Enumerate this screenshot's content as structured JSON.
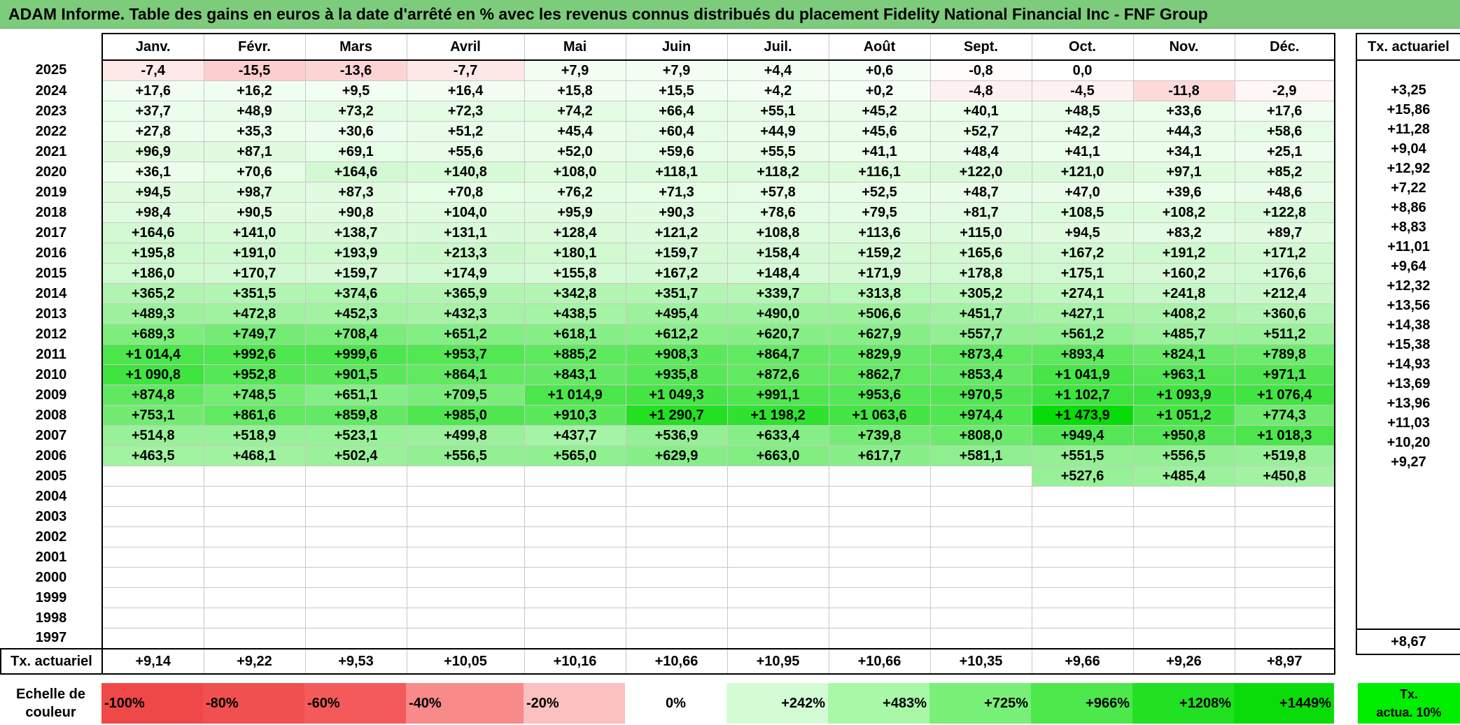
{
  "title": "ADAM Informe. Table des gains en euros à la date d'arrêté en % avec les revenus connus distribués du placement Fidelity National Financial Inc - FNF Group",
  "months": [
    "Janv.",
    "Févr.",
    "Mars",
    "Avril",
    "Mai",
    "Juin",
    "Juil.",
    "Août",
    "Sept.",
    "Oct.",
    "Nov.",
    "Déc."
  ],
  "side_header": "Tx. actuariel",
  "rows": [
    {
      "year": "2025",
      "cells": [
        "-7,4",
        "-15,5",
        "-13,6",
        "-7,7",
        "+7,9",
        "+7,9",
        "+4,4",
        "+0,6",
        "-0,8",
        "0,0",
        "",
        ""
      ],
      "tx": ""
    },
    {
      "year": "2024",
      "cells": [
        "+17,6",
        "+16,2",
        "+9,5",
        "+16,4",
        "+15,8",
        "+15,5",
        "+4,2",
        "+0,2",
        "-4,8",
        "-4,5",
        "-11,8",
        "-2,9"
      ],
      "tx": "+3,25"
    },
    {
      "year": "2023",
      "cells": [
        "+37,7",
        "+48,9",
        "+73,2",
        "+72,3",
        "+74,2",
        "+66,4",
        "+55,1",
        "+45,2",
        "+40,1",
        "+48,5",
        "+33,6",
        "+17,6"
      ],
      "tx": "+15,86"
    },
    {
      "year": "2022",
      "cells": [
        "+27,8",
        "+35,3",
        "+30,6",
        "+51,2",
        "+45,4",
        "+60,4",
        "+44,9",
        "+45,6",
        "+52,7",
        "+42,2",
        "+44,3",
        "+58,6"
      ],
      "tx": "+11,28"
    },
    {
      "year": "2021",
      "cells": [
        "+96,9",
        "+87,1",
        "+69,1",
        "+55,6",
        "+52,0",
        "+59,6",
        "+55,5",
        "+41,1",
        "+48,4",
        "+41,1",
        "+34,1",
        "+25,1"
      ],
      "tx": "+9,04"
    },
    {
      "year": "2020",
      "cells": [
        "+36,1",
        "+70,6",
        "+164,6",
        "+140,8",
        "+108,0",
        "+118,1",
        "+118,2",
        "+116,1",
        "+122,0",
        "+121,0",
        "+97,1",
        "+85,2"
      ],
      "tx": "+12,92"
    },
    {
      "year": "2019",
      "cells": [
        "+94,5",
        "+98,7",
        "+87,3",
        "+70,8",
        "+76,2",
        "+71,3",
        "+57,8",
        "+52,5",
        "+48,7",
        "+47,0",
        "+39,6",
        "+48,6"
      ],
      "tx": "+7,22"
    },
    {
      "year": "2018",
      "cells": [
        "+98,4",
        "+90,5",
        "+90,8",
        "+104,0",
        "+95,9",
        "+90,3",
        "+78,6",
        "+79,5",
        "+81,7",
        "+108,5",
        "+108,2",
        "+122,8"
      ],
      "tx": "+8,86"
    },
    {
      "year": "2017",
      "cells": [
        "+164,6",
        "+141,0",
        "+138,7",
        "+131,1",
        "+128,4",
        "+121,2",
        "+108,8",
        "+113,6",
        "+115,0",
        "+94,5",
        "+83,2",
        "+89,7"
      ],
      "tx": "+8,83"
    },
    {
      "year": "2016",
      "cells": [
        "+195,8",
        "+191,0",
        "+193,9",
        "+213,3",
        "+180,1",
        "+159,7",
        "+158,4",
        "+159,2",
        "+165,6",
        "+167,2",
        "+191,2",
        "+171,2"
      ],
      "tx": "+11,01"
    },
    {
      "year": "2015",
      "cells": [
        "+186,0",
        "+170,7",
        "+159,7",
        "+174,9",
        "+155,8",
        "+167,2",
        "+148,4",
        "+171,9",
        "+178,8",
        "+175,1",
        "+160,2",
        "+176,6"
      ],
      "tx": "+9,64"
    },
    {
      "year": "2014",
      "cells": [
        "+365,2",
        "+351,5",
        "+374,6",
        "+365,9",
        "+342,8",
        "+351,7",
        "+339,7",
        "+313,8",
        "+305,2",
        "+274,1",
        "+241,8",
        "+212,4"
      ],
      "tx": "+12,32"
    },
    {
      "year": "2013",
      "cells": [
        "+489,3",
        "+472,8",
        "+452,3",
        "+432,3",
        "+438,5",
        "+495,4",
        "+490,0",
        "+506,6",
        "+451,7",
        "+427,1",
        "+408,2",
        "+360,6"
      ],
      "tx": "+13,56"
    },
    {
      "year": "2012",
      "cells": [
        "+689,3",
        "+749,7",
        "+708,4",
        "+651,2",
        "+618,1",
        "+612,2",
        "+620,7",
        "+627,9",
        "+557,7",
        "+561,2",
        "+485,7",
        "+511,2"
      ],
      "tx": "+14,38"
    },
    {
      "year": "2011",
      "cells": [
        "+1 014,4",
        "+992,6",
        "+999,6",
        "+953,7",
        "+885,2",
        "+908,3",
        "+864,7",
        "+829,9",
        "+873,4",
        "+893,4",
        "+824,1",
        "+789,8"
      ],
      "tx": "+15,38"
    },
    {
      "year": "2010",
      "cells": [
        "+1 090,8",
        "+952,8",
        "+901,5",
        "+864,1",
        "+843,1",
        "+935,8",
        "+872,6",
        "+862,7",
        "+853,4",
        "+1 041,9",
        "+963,1",
        "+971,1"
      ],
      "tx": "+14,93"
    },
    {
      "year": "2009",
      "cells": [
        "+874,8",
        "+748,5",
        "+651,1",
        "+709,5",
        "+1 014,9",
        "+1 049,3",
        "+991,1",
        "+953,6",
        "+970,5",
        "+1 102,7",
        "+1 093,9",
        "+1 076,4"
      ],
      "tx": "+13,69"
    },
    {
      "year": "2008",
      "cells": [
        "+753,1",
        "+861,6",
        "+859,8",
        "+985,0",
        "+910,3",
        "+1 290,7",
        "+1 198,2",
        "+1 063,6",
        "+974,4",
        "+1 473,9",
        "+1 051,2",
        "+774,3"
      ],
      "tx": "+13,96"
    },
    {
      "year": "2007",
      "cells": [
        "+514,8",
        "+518,9",
        "+523,1",
        "+499,8",
        "+437,7",
        "+536,9",
        "+633,4",
        "+739,8",
        "+808,0",
        "+949,4",
        "+950,8",
        "+1 018,3"
      ],
      "tx": "+11,03"
    },
    {
      "year": "2006",
      "cells": [
        "+463,5",
        "+468,1",
        "+502,4",
        "+556,5",
        "+565,0",
        "+629,9",
        "+663,0",
        "+617,7",
        "+581,1",
        "+551,5",
        "+556,5",
        "+519,8"
      ],
      "tx": "+10,20"
    },
    {
      "year": "2005",
      "cells": [
        "",
        "",
        "",
        "",
        "",
        "",
        "",
        "",
        "",
        "+527,6",
        "+485,4",
        "+450,8"
      ],
      "tx": "+9,27"
    },
    {
      "year": "2004",
      "cells": [
        "",
        "",
        "",
        "",
        "",
        "",
        "",
        "",
        "",
        "",
        "",
        ""
      ],
      "tx": ""
    },
    {
      "year": "2003",
      "cells": [
        "",
        "",
        "",
        "",
        "",
        "",
        "",
        "",
        "",
        "",
        "",
        ""
      ],
      "tx": ""
    },
    {
      "year": "2002",
      "cells": [
        "",
        "",
        "",
        "",
        "",
        "",
        "",
        "",
        "",
        "",
        "",
        ""
      ],
      "tx": ""
    },
    {
      "year": "2001",
      "cells": [
        "",
        "",
        "",
        "",
        "",
        "",
        "",
        "",
        "",
        "",
        "",
        ""
      ],
      "tx": ""
    },
    {
      "year": "2000",
      "cells": [
        "",
        "",
        "",
        "",
        "",
        "",
        "",
        "",
        "",
        "",
        "",
        ""
      ],
      "tx": ""
    },
    {
      "year": "1999",
      "cells": [
        "",
        "",
        "",
        "",
        "",
        "",
        "",
        "",
        "",
        "",
        "",
        ""
      ],
      "tx": ""
    },
    {
      "year": "1998",
      "cells": [
        "",
        "",
        "",
        "",
        "",
        "",
        "",
        "",
        "",
        "",
        "",
        ""
      ],
      "tx": ""
    },
    {
      "year": "1997",
      "cells": [
        "",
        "",
        "",
        "",
        "",
        "",
        "",
        "",
        "",
        "",
        "",
        ""
      ],
      "tx": ""
    }
  ],
  "footer": {
    "label": "Tx. actuariel",
    "cells": [
      "+9,14",
      "+9,22",
      "+9,53",
      "+10,05",
      "+10,16",
      "+10,66",
      "+10,95",
      "+10,66",
      "+10,35",
      "+9,66",
      "+9,26",
      "+8,97"
    ],
    "tx": "+8,67"
  },
  "legend": {
    "label_line1": "Echelle de",
    "label_line2": "couleur",
    "items": [
      {
        "label": "-100%",
        "color": "#f04848"
      },
      {
        "label": "-80%",
        "color": "#f05050"
      },
      {
        "label": "-60%",
        "color": "#f55a5a"
      },
      {
        "label": "-40%",
        "color": "#f88a8a"
      },
      {
        "label": "-20%",
        "color": "#fcc0c0"
      },
      {
        "label": "0%",
        "color": "#ffffff"
      },
      {
        "label": "+242%",
        "color": "#d4fcd4"
      },
      {
        "label": "+483%",
        "color": "#a8f8a8"
      },
      {
        "label": "+725%",
        "color": "#78f078"
      },
      {
        "label": "+966%",
        "color": "#4ce84c"
      },
      {
        "label": "+1208%",
        "color": "#22e022"
      },
      {
        "label": "+1449%",
        "color": "#0adc0a"
      }
    ],
    "tx_line1": "Tx.",
    "tx_line2": "actua. 10%"
  }
}
